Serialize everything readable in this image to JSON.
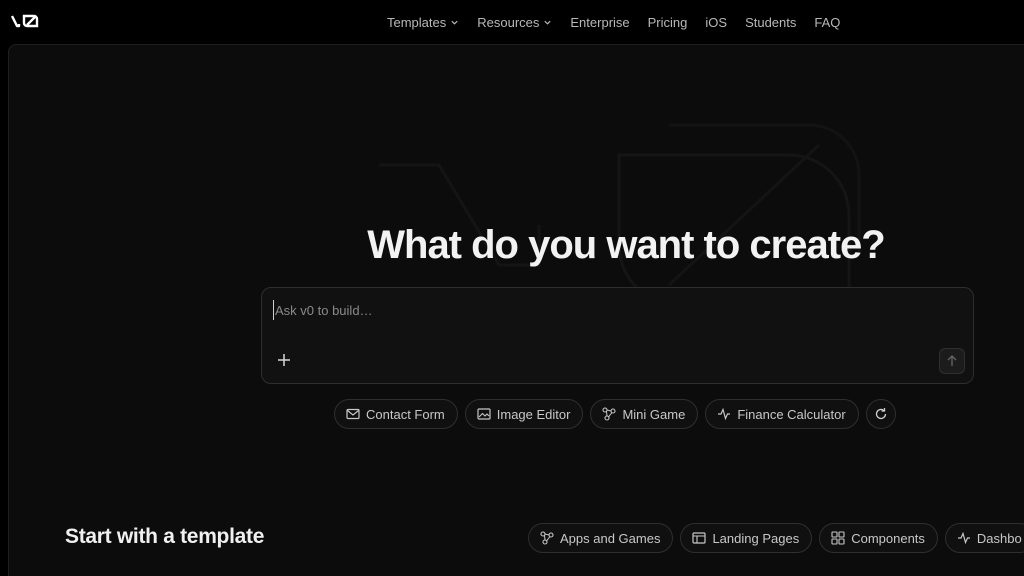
{
  "brand": {
    "logo_text": "v0"
  },
  "nav": {
    "items": [
      {
        "label": "Templates",
        "dropdown": true
      },
      {
        "label": "Resources",
        "dropdown": true
      },
      {
        "label": "Enterprise",
        "dropdown": false
      },
      {
        "label": "Pricing",
        "dropdown": false
      },
      {
        "label": "iOS",
        "dropdown": false
      },
      {
        "label": "Students",
        "dropdown": false
      },
      {
        "label": "FAQ",
        "dropdown": false
      }
    ]
  },
  "hero": {
    "title": "What do you want to create?"
  },
  "prompt": {
    "placeholder": "Ask v0 to build…",
    "value": ""
  },
  "suggestions": [
    {
      "label": "Contact Form",
      "icon": "mail-icon"
    },
    {
      "label": "Image Editor",
      "icon": "image-icon"
    },
    {
      "label": "Mini Game",
      "icon": "nodes-icon"
    },
    {
      "label": "Finance Calculator",
      "icon": "activity-icon"
    }
  ],
  "templates": {
    "title": "Start with a template",
    "categories": [
      {
        "label": "Apps and Games",
        "icon": "nodes-icon"
      },
      {
        "label": "Landing Pages",
        "icon": "layout-icon"
      },
      {
        "label": "Components",
        "icon": "grid-icon"
      },
      {
        "label": "Dashbo",
        "icon": "activity-icon"
      }
    ]
  },
  "colors": {
    "background": "#000000",
    "panel": "#0c0c0c",
    "text": "#ededed",
    "muted": "#b8b8b8",
    "border": "#2f2f2f"
  }
}
